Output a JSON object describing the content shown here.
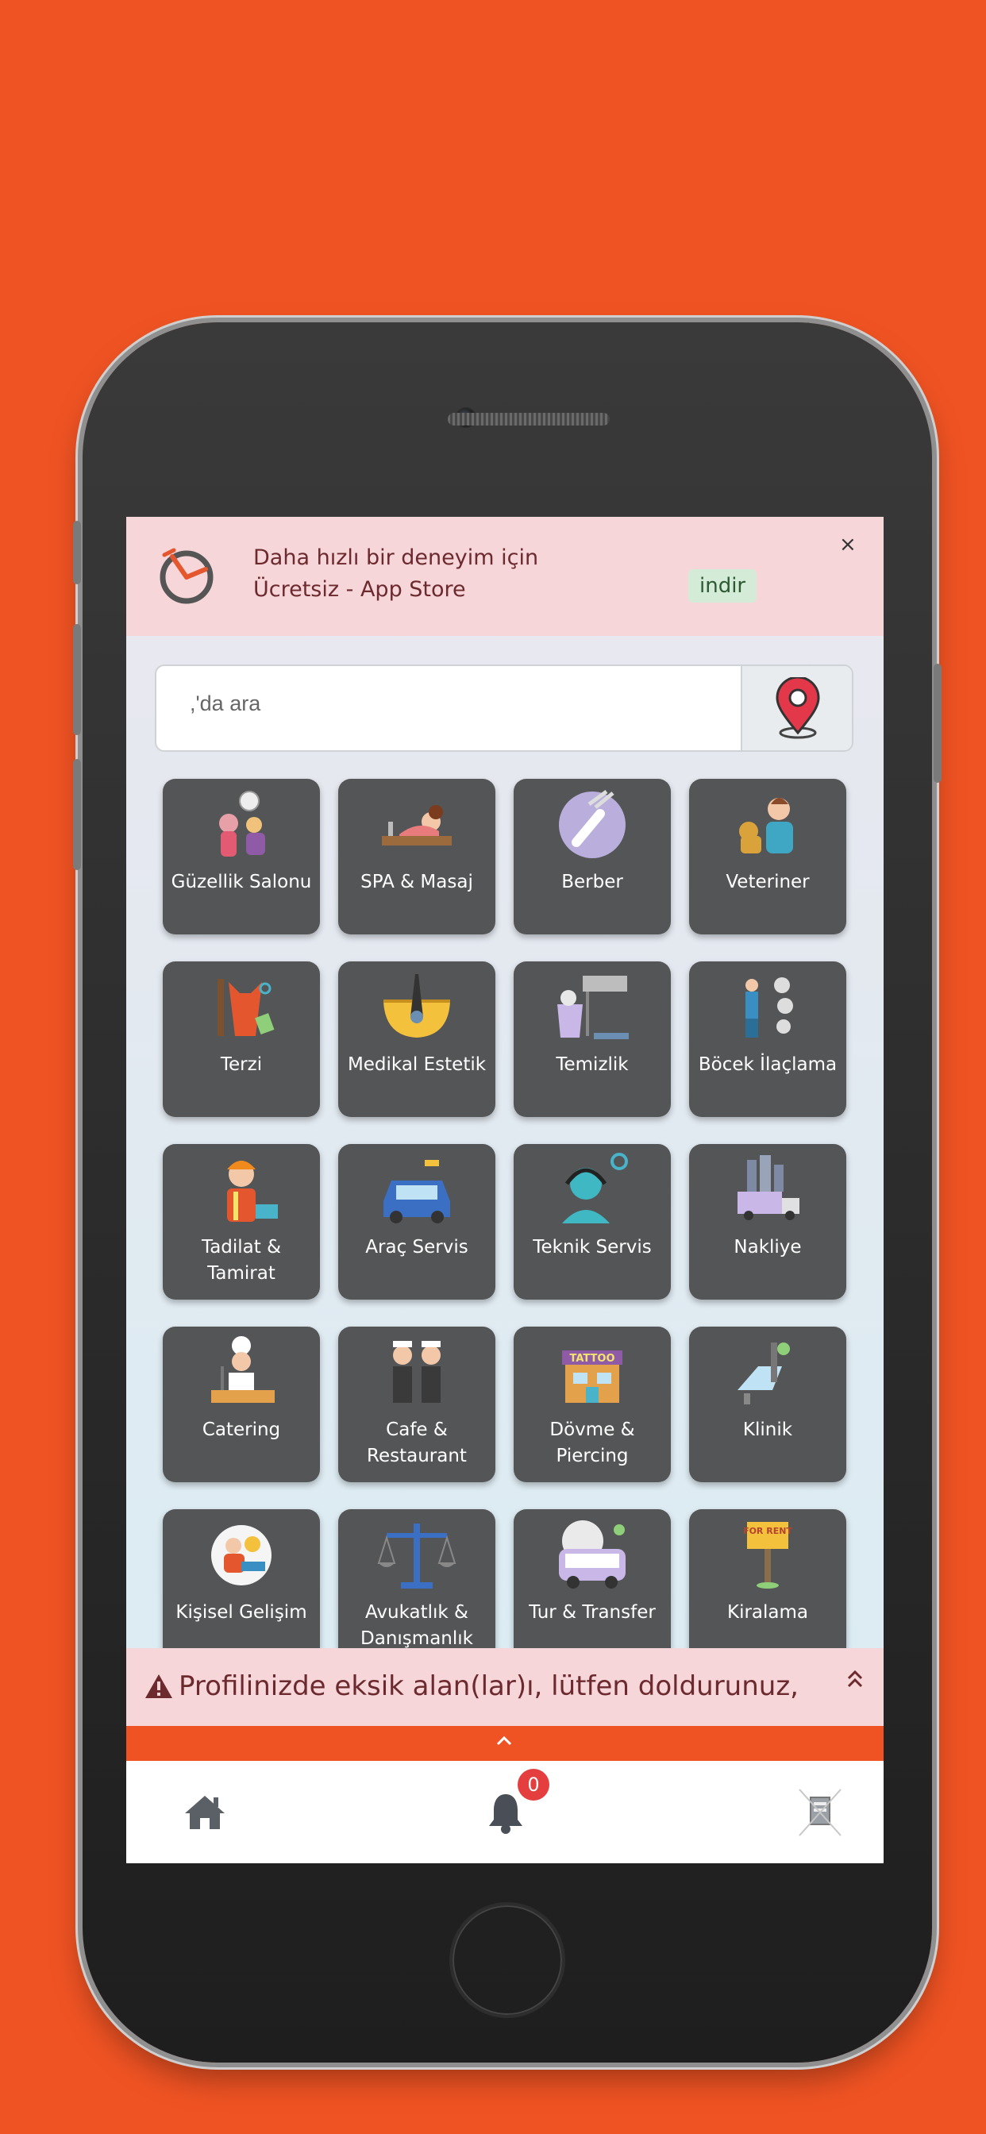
{
  "banner": {
    "line1": "Daha hızlı bir deneyim için",
    "line2": "Ücretsiz - App Store",
    "download": "indir",
    "close": "×"
  },
  "search": {
    "placeholder": ",'da ara",
    "location_icon": "location-pin-icon"
  },
  "categories": [
    {
      "label": "Güzellik Salonu",
      "icon": "beauty-salon-icon"
    },
    {
      "label": "SPA & Masaj",
      "icon": "spa-massage-icon"
    },
    {
      "label": "Berber",
      "icon": "barber-razor-icon"
    },
    {
      "label": "Veteriner",
      "icon": "veterinarian-icon"
    },
    {
      "label": "Terzi",
      "icon": "tailor-icon"
    },
    {
      "label": "Medikal Estetik",
      "icon": "medical-aesthetic-icon"
    },
    {
      "label": "Temizlik",
      "icon": "cleaning-icon"
    },
    {
      "label": "Böcek İlaçlama",
      "icon": "pest-control-icon"
    },
    {
      "label": "Tadilat & Tamirat",
      "icon": "repair-worker-icon"
    },
    {
      "label": "Araç Servis",
      "icon": "car-service-icon"
    },
    {
      "label": "Teknik Servis",
      "icon": "technical-support-icon"
    },
    {
      "label": "Nakliye",
      "icon": "moving-truck-icon"
    },
    {
      "label": "Catering",
      "icon": "chef-catering-icon"
    },
    {
      "label": "Cafe & Restaurant",
      "icon": "cafe-restaurant-icon"
    },
    {
      "label": "Dövme & Piercing",
      "icon": "tattoo-shop-icon"
    },
    {
      "label": "Klinik",
      "icon": "dental-clinic-icon"
    },
    {
      "label": "Kişisel Gelişim",
      "icon": "personal-development-icon"
    },
    {
      "label": "Avukatlık & Danışmanlık",
      "icon": "law-scales-icon"
    },
    {
      "label": "Tur & Transfer",
      "icon": "tour-bus-icon"
    },
    {
      "label": "Kiralama",
      "icon": "for-rent-sign-icon"
    }
  ],
  "rent_sign_text": "FOR RENT",
  "tattoo_sign_text": "TATTOO",
  "alert": {
    "message": "Profilinizde eksik alan(lar)ı, lütfen doldurunuz,"
  },
  "bottom_nav": {
    "notification_count": "0"
  },
  "colors": {
    "accent": "#f05323",
    "tile": "#545556",
    "banner_bg": "#f6d6d9",
    "alert_text": "#6c2a2f",
    "badge": "#e43e3e"
  }
}
